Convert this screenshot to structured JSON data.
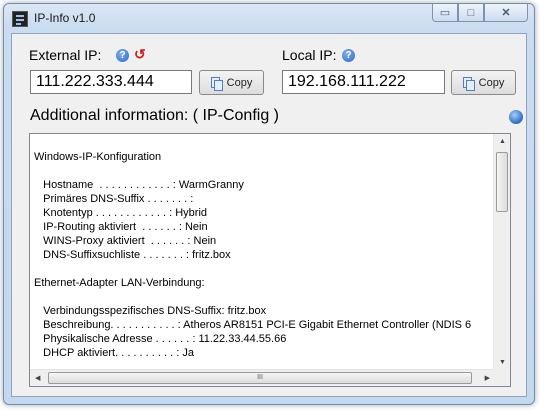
{
  "window": {
    "title": "IP-Info v1.0"
  },
  "external": {
    "label": "External IP:",
    "value": "111.222.333.444",
    "copy_label": "Copy"
  },
  "local": {
    "label": "Local IP:",
    "value": "192.168.111.222",
    "copy_label": "Copy"
  },
  "info": {
    "title": "Additional information: ( IP-Config )",
    "lines": [
      "Windows-IP-Konfiguration",
      "",
      "   Hostname  . . . . . . . . . . . . : WarmGranny",
      "   Primäres DNS-Suffix . . . . . . . :",
      "   Knotentyp . . . . . . . . . . . . : Hybrid",
      "   IP-Routing aktiviert  . . . . . . : Nein",
      "   WINS-Proxy aktiviert  . . . . . . : Nein",
      "   DNS-Suffixsuchliste . . . . . . . : fritz.box",
      "",
      "Ethernet-Adapter LAN-Verbindung:",
      "",
      "   Verbindungsspezifisches DNS-Suffix: fritz.box",
      "   Beschreibung. . . . . . . . . . . : Atheros AR8151 PCI-E Gigabit Ethernet Controller (NDIS 6",
      "   Physikalische Adresse . . . . . . : 11.22.33.44.55.66",
      "   DHCP aktiviert. . . . . . . . . . : Ja"
    ]
  },
  "icons": {
    "info": "info-icon",
    "refresh": "refresh-icon",
    "copy": "copy-icon",
    "globe": "globe-icon",
    "minimize": "minimize-icon",
    "maximize": "maximize-icon",
    "close": "close-icon"
  },
  "colors": {
    "refresh": "#cc1f1f",
    "info_icon": "#2b67c6"
  }
}
